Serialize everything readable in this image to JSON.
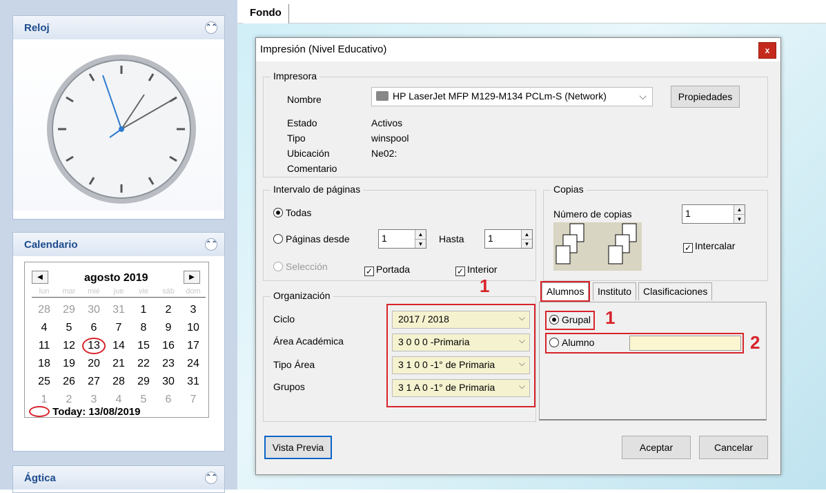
{
  "sidebar": {
    "clock_title": "Reloj",
    "calendar_title": "Calendario",
    "agtica_title": "Ágtica",
    "month": "agosto 2019",
    "today_label": "Today: 13/08/2019",
    "day_headers": [
      "lun",
      "mar",
      "mié",
      "jue",
      "vie",
      "sáb",
      "dom"
    ],
    "days": [
      "28",
      "29",
      "30",
      "31",
      "1",
      "2",
      "3",
      "4",
      "5",
      "6",
      "7",
      "8",
      "9",
      "10",
      "11",
      "12",
      "13",
      "14",
      "15",
      "16",
      "17",
      "18",
      "19",
      "20",
      "21",
      "22",
      "23",
      "24",
      "25",
      "26",
      "27",
      "28",
      "29",
      "30",
      "31",
      "1",
      "2",
      "3",
      "4",
      "5",
      "6",
      "7"
    ]
  },
  "tab_fondo": "Fondo",
  "dialog": {
    "title": "Impresión (Nivel Educativo)",
    "close": "x",
    "printer": {
      "group": "Impresora",
      "nombre_label": "Nombre",
      "printer_name": "HP LaserJet MFP M129-M134 PCLm-S (Network)",
      "propiedades": "Propiedades",
      "estado_label": "Estado",
      "estado": "Activos",
      "tipo_label": "Tipo",
      "tipo": "winspool",
      "ubicacion_label": "Ubicación",
      "ubicacion": "Ne02:",
      "comentario_label": "Comentario"
    },
    "range": {
      "group": "Intervalo de páginas",
      "todas": "Todas",
      "paginas_desde": "Páginas desde",
      "desde": "1",
      "hasta_label": "Hasta",
      "hasta": "1",
      "seleccion": "Selección",
      "portada": "Portada",
      "interior": "Interior"
    },
    "copies": {
      "group": "Copias",
      "numero_label": "Número de copias",
      "numero": "1",
      "intercalar": "Intercalar"
    },
    "org": {
      "group": "Organización",
      "ciclo_label": "Ciclo",
      "ciclo": "2017 / 2018",
      "area_label": "Área Académica",
      "area": "3 0 0 0 -Primaria",
      "tipo_area_label": "Tipo Área",
      "tipo_area": "3 1 0 0 -1° de Primaria",
      "grupos_label": "Grupos",
      "grupos": "3 1 A 0 -1° de Primaria"
    },
    "tabs": [
      "Alumnos",
      "Instituto",
      "Clasificaciones"
    ],
    "alumnos": {
      "grupal": "Grupal",
      "alumno": "Alumno",
      "alumno_value": ""
    },
    "vista_previa": "Vista Previa",
    "aceptar": "Aceptar",
    "cancelar": "Cancelar"
  },
  "annotations": {
    "n1a": "1",
    "n1b": "1",
    "n2": "2"
  }
}
